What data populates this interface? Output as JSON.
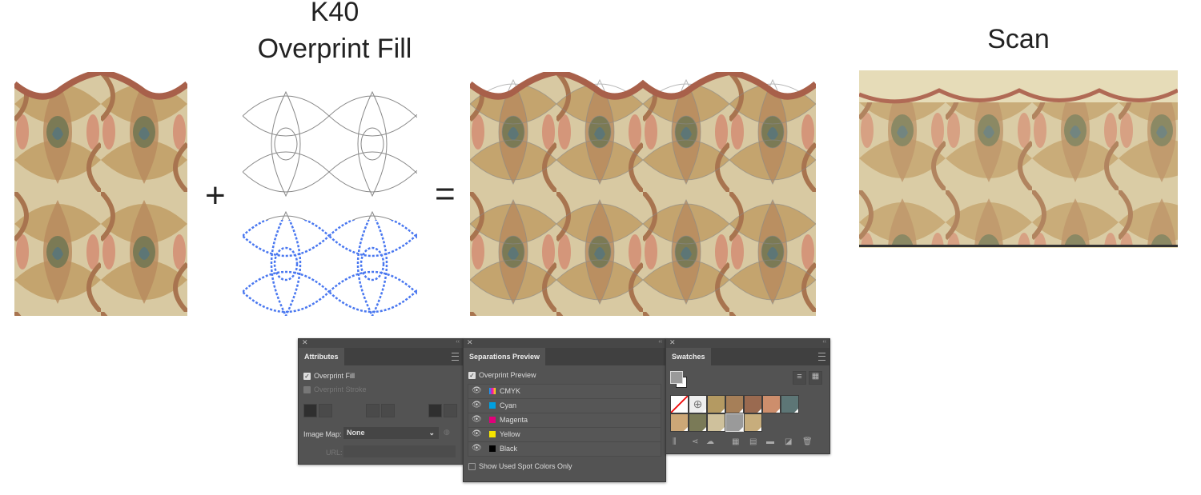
{
  "headings": {
    "k40": "K40",
    "overprint_fill": "Overprint Fill",
    "scan": "Scan",
    "plus": "+",
    "equals": "="
  },
  "attributes": {
    "tab": "Attributes",
    "overprint_fill": "Overprint Fill",
    "overprint_stroke": "Overprint Stroke",
    "image_map_label": "Image Map:",
    "image_map_value": "None",
    "url_label": "URL:"
  },
  "separations": {
    "tab": "Separations Preview",
    "overprint_preview": "Overprint Preview",
    "channels": [
      {
        "label": "CMYK",
        "color": "#444444"
      },
      {
        "label": "Cyan",
        "color": "#00a0e0"
      },
      {
        "label": "Magenta",
        "color": "#e0007a"
      },
      {
        "label": "Yellow",
        "color": "#f5e400"
      },
      {
        "label": "Black",
        "color": "#000000"
      }
    ],
    "spot_only": "Show Used Spot Colors Only"
  },
  "swatches": {
    "tab": "Swatches",
    "colors": [
      "#b49a62",
      "#a67f58",
      "#9a6a50",
      "#cd8e6c",
      "#5d7676",
      "#cca777",
      "#7a7a57",
      "#cfc19c",
      "#9a9a9a",
      "#c7ad7c"
    ]
  }
}
